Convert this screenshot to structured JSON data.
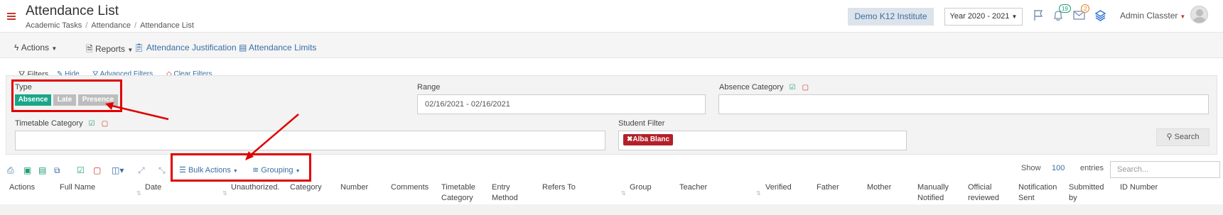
{
  "header": {
    "title": "Attendance List",
    "breadcrumb": [
      "Academic Tasks",
      "Attendance",
      "Attendance List"
    ],
    "breadcrumb_sep": "/",
    "institute": "Demo K12 Institute",
    "year": "Year 2020 - 2021",
    "notifications_count": "19",
    "messages_count": "2",
    "user": "Admin Classter",
    "icons": [
      "menu-icon",
      "flag-icon",
      "bell-icon",
      "envelope-icon",
      "layers-icon"
    ]
  },
  "toolbar": {
    "actions": "Actions",
    "reports": "Reports",
    "justification": "Attendance Justification",
    "limits": "Attendance Limits"
  },
  "filters": {
    "title": "Filters",
    "hide": "Hide",
    "advanced": "Advanced Filters",
    "clear": "Clear Filters",
    "type_label": "Type",
    "type_options": [
      "Absence",
      "Late",
      "Presence"
    ],
    "range_label": "Range",
    "range_value": "02/16/2021 - 02/16/2021",
    "absence_category_label": "Absence Category",
    "timetable_category_label": "Timetable Category",
    "student_filter_label": "Student Filter",
    "student_tag": "Alba Blanc",
    "search_button": "Search"
  },
  "table_toolbar": {
    "bulk_actions": "Bulk Actions",
    "grouping": "Grouping",
    "show_label": "Show",
    "show_value": "100",
    "entries_label": "entries",
    "search_placeholder": "Search..."
  },
  "table": {
    "columns": [
      [
        "Actions"
      ],
      [
        "Full Name"
      ],
      [
        "Date"
      ],
      [
        "Unauthorized."
      ],
      [
        "Category"
      ],
      [
        "Number"
      ],
      [
        "Comments"
      ],
      [
        "Timetable",
        "Category"
      ],
      [
        "Entry",
        "Method"
      ],
      [
        "Refers To"
      ],
      [
        "Group"
      ],
      [
        "Teacher"
      ],
      [
        "Verified"
      ],
      [
        "Father"
      ],
      [
        "Mother"
      ],
      [
        "Manually",
        "Notified"
      ],
      [
        "Official",
        "reviewed"
      ],
      [
        "Notification",
        "Sent"
      ],
      [
        "Submitted",
        "by"
      ],
      [
        "ID Number"
      ]
    ]
  },
  "colors": {
    "accent": "#3a6ea5",
    "absence_button": "#1aa689",
    "inactive_button": "#bdbdbd",
    "highlight": "#e00000",
    "tag": "#b3202a"
  }
}
